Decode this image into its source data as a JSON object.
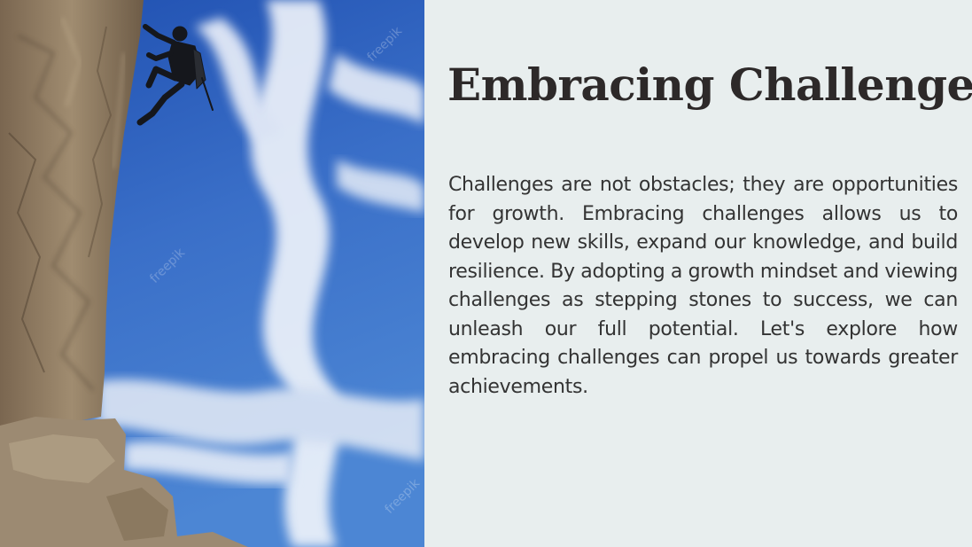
{
  "slide": {
    "title": "Embracing Challenges",
    "body": "Challenges are not obstacles; they are opportunities for growth. Embracing challenges allows us to develop new skills, expand our knowledge, and build resilience. By adopting a growth mindset and viewing challenges as stepping stones to success, we can unleash our full potential. Let's explore how embracing challenges can propel us towards greater achievements.",
    "background_color": "#e8eeee",
    "title_color": "#2d2929",
    "text_color": "#333333"
  },
  "photo": {
    "watermark": "freepik",
    "sky_color": "#2f63c0",
    "rock_color": "#8e7a62"
  }
}
